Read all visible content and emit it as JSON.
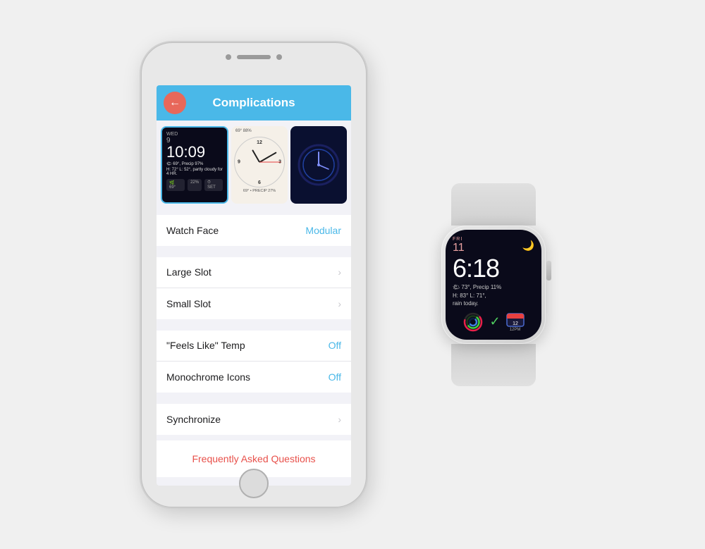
{
  "scene": {
    "bg_color": "#f0f0f0"
  },
  "iphone": {
    "header": {
      "title": "Complications",
      "back_label": "‹"
    },
    "watch_previews": [
      {
        "type": "modular",
        "active": true,
        "time": "10:09",
        "day": "WED",
        "date": "9",
        "weather": "69°, Precip 97%",
        "detail": "H: 72° L: 52°, partly cloudy for 4 HR.",
        "stat1": "69°",
        "stat2": "22%",
        "stat3": "SET"
      },
      {
        "type": "analog",
        "active": false,
        "temp": "69°",
        "humidity": "88%",
        "footer": "69° • PRECIP 27%"
      },
      {
        "type": "blue_analog",
        "active": false
      }
    ],
    "settings": [
      {
        "section": "watch_face",
        "items": [
          {
            "label": "Watch Face",
            "value": "Modular",
            "chevron": false
          }
        ]
      },
      {
        "section": "slots",
        "items": [
          {
            "label": "Large Slot",
            "value": "",
            "chevron": true
          },
          {
            "label": "Small Slot",
            "value": "",
            "chevron": true
          }
        ]
      },
      {
        "section": "options",
        "items": [
          {
            "label": "\"Feels Like\" Temp",
            "value": "Off",
            "chevron": false
          },
          {
            "label": "Monochrome Icons",
            "value": "Off",
            "chevron": false
          }
        ]
      },
      {
        "section": "sync",
        "items": [
          {
            "label": "Synchronize",
            "value": "",
            "chevron": true
          }
        ]
      }
    ],
    "faq": {
      "label": "Frequently Asked Questions"
    }
  },
  "apple_watch": {
    "day": "FRI",
    "date": "11",
    "time": "6:18",
    "moon_icon": "🌙",
    "weather_line1": "🌤 73°, Precip 11%",
    "weather_line2": "H: 83° L: 71°,",
    "weather_line3": "rain today.",
    "complications": [
      {
        "type": "activity",
        "label": ""
      },
      {
        "type": "check",
        "label": "✓"
      },
      {
        "type": "calendar",
        "label": "📅",
        "sub": "12PM"
      }
    ]
  }
}
